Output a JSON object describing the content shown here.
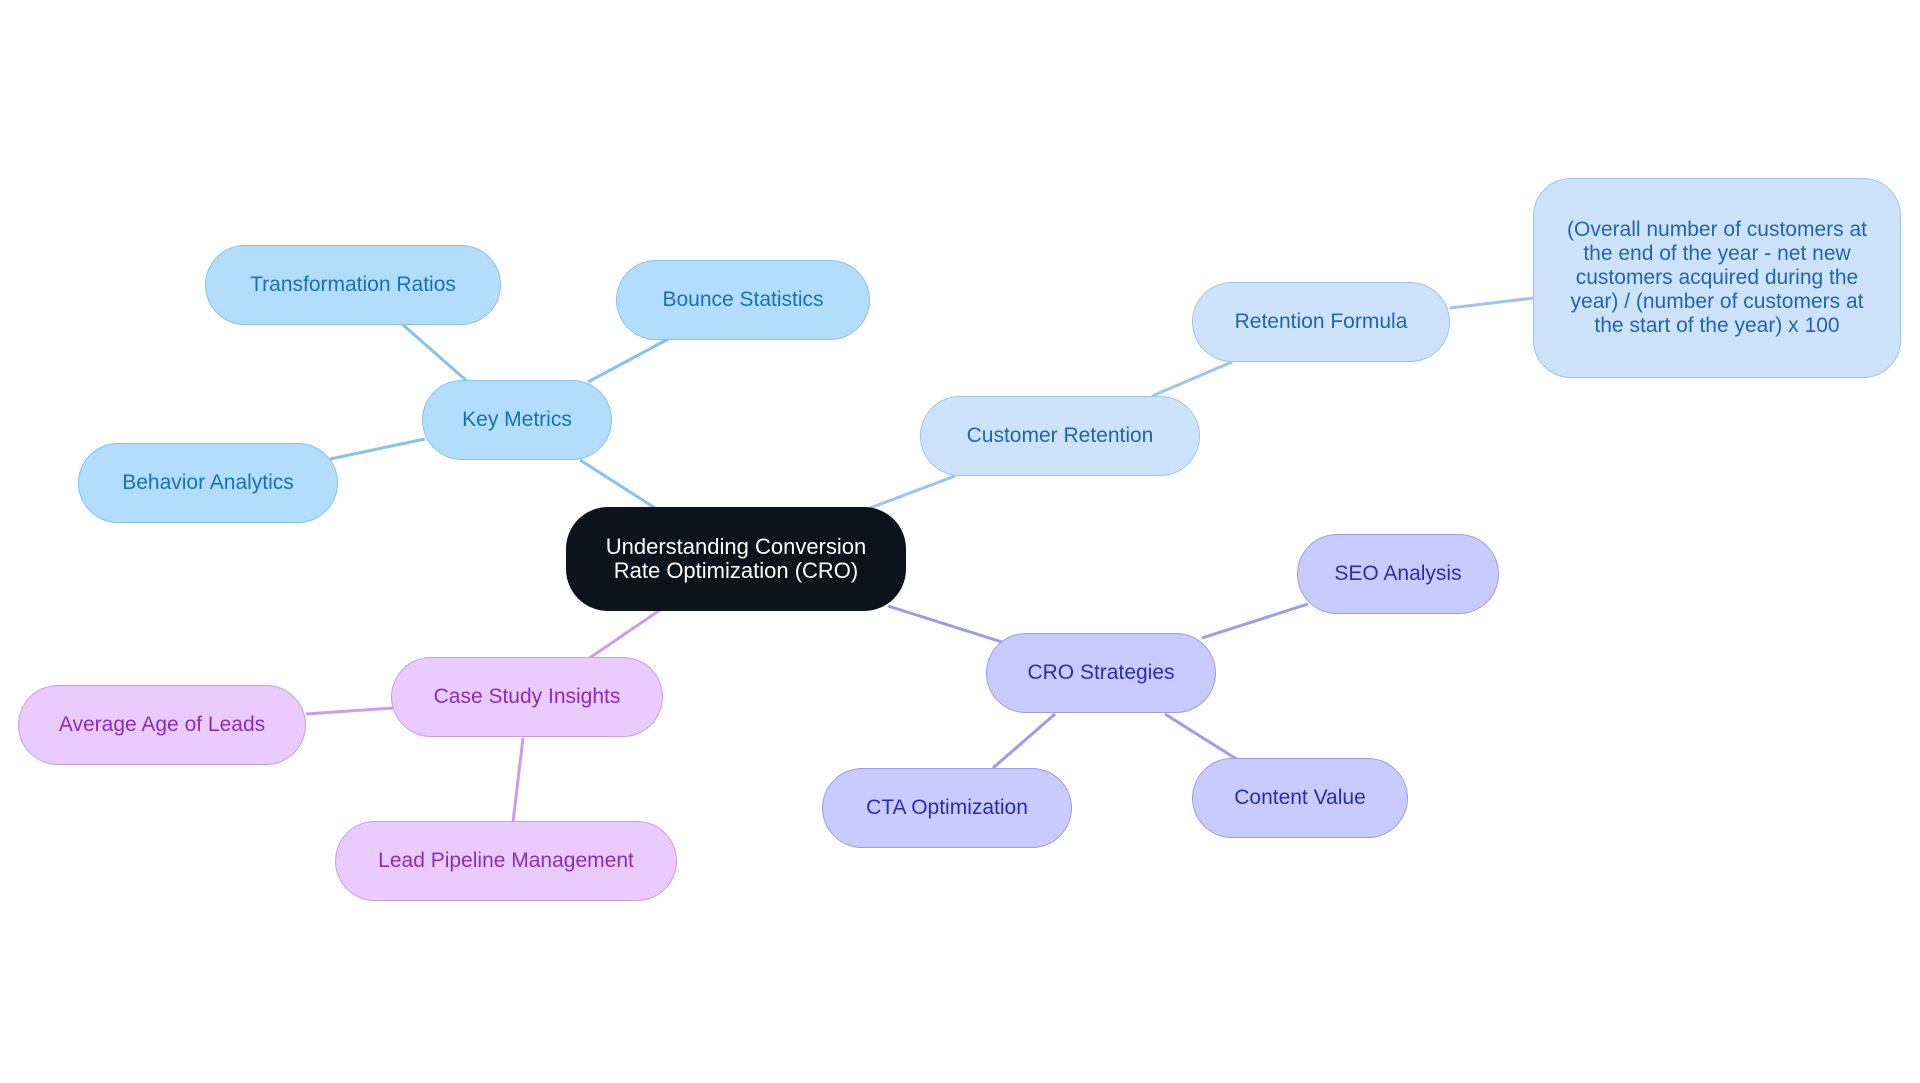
{
  "title": "Understanding Conversion Rate Optimization (CRO)",
  "colors": {
    "root_fill": "#0d131a",
    "key_metrics_branch": "#b3ddfc",
    "customer_retention_branch": "#cde3fb",
    "cro_strategies_branch": "#c8cbfd",
    "case_study_branch": "#e9cbfd"
  },
  "nodes": {
    "root": "Understanding Conversion Rate Optimization (CRO)",
    "key_metrics": "Key Metrics",
    "transformation_ratios": "Transformation Ratios",
    "bounce_statistics": "Bounce Statistics",
    "behavior_analytics": "Behavior Analytics",
    "customer_retention": "Customer Retention",
    "retention_formula": "Retention Formula",
    "formula_text": "(Overall number of customers at the end of the year - net new customers acquired during the year) / (number of customers at the start of the year) x 100",
    "cro_strategies": "CRO Strategies",
    "seo_analysis": "SEO Analysis",
    "cta_optimization": "CTA Optimization",
    "content_value": "Content Value",
    "case_study_insights": "Case Study Insights",
    "average_age_of_leads": "Average Age of Leads",
    "lead_pipeline_management": "Lead Pipeline Management"
  },
  "edges": [
    [
      "root",
      "key_metrics"
    ],
    [
      "key_metrics",
      "transformation_ratios"
    ],
    [
      "key_metrics",
      "bounce_statistics"
    ],
    [
      "key_metrics",
      "behavior_analytics"
    ],
    [
      "root",
      "customer_retention"
    ],
    [
      "customer_retention",
      "retention_formula"
    ],
    [
      "retention_formula",
      "formula_text"
    ],
    [
      "root",
      "cro_strategies"
    ],
    [
      "cro_strategies",
      "seo_analysis"
    ],
    [
      "cro_strategies",
      "cta_optimization"
    ],
    [
      "cro_strategies",
      "content_value"
    ],
    [
      "root",
      "case_study_insights"
    ],
    [
      "case_study_insights",
      "average_age_of_leads"
    ],
    [
      "case_study_insights",
      "lead_pipeline_management"
    ]
  ]
}
